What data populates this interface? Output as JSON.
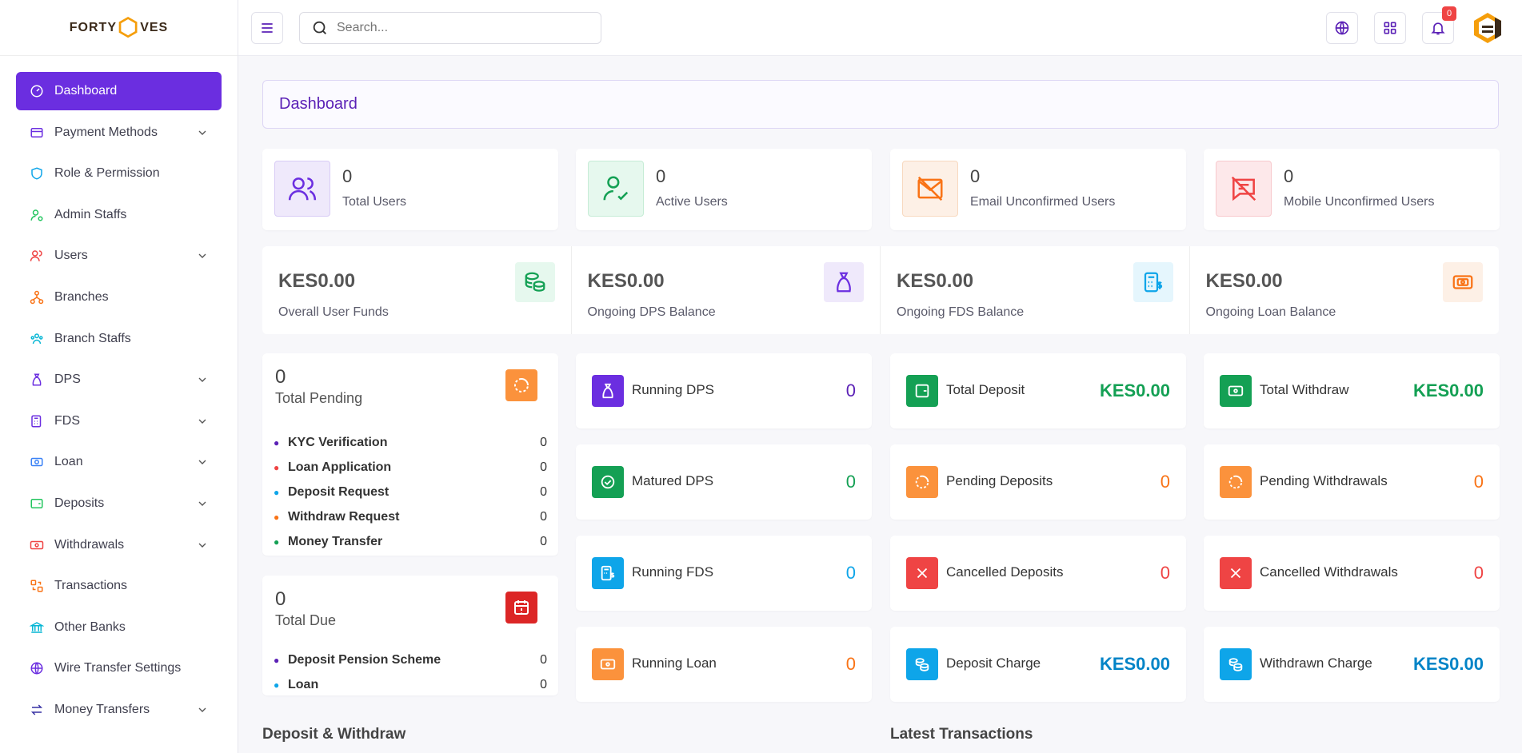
{
  "brand": {
    "logo_left": "FORTY",
    "logo_mid": "H",
    "logo_right": "VES"
  },
  "colors": {
    "accent": "#6b2ee0",
    "green": "#14a054",
    "orange": "#f97316",
    "red": "#ef4444",
    "blue": "#0ea5e9",
    "purple": "#5b21b6"
  },
  "sidebar": {
    "items": [
      {
        "label": "Dashboard",
        "icon": "dashboard-icon"
      },
      {
        "label": "Payment Methods",
        "icon": "credit-card-icon"
      },
      {
        "label": "Role & Permission",
        "icon": "shield-icon"
      },
      {
        "label": "Admin Staffs",
        "icon": "user-gear-icon"
      },
      {
        "label": "Users",
        "icon": "users-icon"
      },
      {
        "label": "Branches",
        "icon": "branches-icon"
      },
      {
        "label": "Branch Staffs",
        "icon": "staff-group-icon"
      },
      {
        "label": "DPS",
        "icon": "money-bag-icon"
      },
      {
        "label": "FDS",
        "icon": "calculator-icon"
      },
      {
        "label": "Loan",
        "icon": "loan-icon"
      },
      {
        "label": "Deposits",
        "icon": "wallet-icon"
      },
      {
        "label": "Withdrawals",
        "icon": "cash-icon"
      },
      {
        "label": "Transactions",
        "icon": "transfer-icon"
      },
      {
        "label": "Other Banks",
        "icon": "bank-icon"
      },
      {
        "label": "Wire Transfer Settings",
        "icon": "globe-icon"
      },
      {
        "label": "Money Transfers",
        "icon": "arrows-icon"
      }
    ]
  },
  "header": {
    "search_placeholder": "Search...",
    "notification_count": "0"
  },
  "page_title": "Dashboard",
  "stats": [
    {
      "value": "0",
      "label": "Total Users"
    },
    {
      "value": "0",
      "label": "Active Users"
    },
    {
      "value": "0",
      "label": "Email Unconfirmed Users"
    },
    {
      "value": "0",
      "label": "Mobile Unconfirmed Users"
    }
  ],
  "funds": [
    {
      "amount": "KES0.00",
      "label": "Overall User Funds"
    },
    {
      "amount": "KES0.00",
      "label": "Ongoing DPS Balance"
    },
    {
      "amount": "KES0.00",
      "label": "Ongoing FDS Balance"
    },
    {
      "amount": "KES0.00",
      "label": "Ongoing Loan Balance"
    }
  ],
  "pending": {
    "value": "0",
    "label": "Total Pending",
    "rows": [
      {
        "name": "KYC Verification",
        "value": "0"
      },
      {
        "name": "Loan Application",
        "value": "0"
      },
      {
        "name": "Deposit Request",
        "value": "0"
      },
      {
        "name": "Withdraw Request",
        "value": "0"
      },
      {
        "name": "Money Transfer",
        "value": "0"
      }
    ]
  },
  "due": {
    "value": "0",
    "label": "Total Due",
    "rows": [
      {
        "name": "Deposit Pension Scheme",
        "value": "0"
      },
      {
        "name": "Loan",
        "value": "0"
      }
    ]
  },
  "metrics": {
    "running_dps": {
      "name": "Running DPS",
      "value": "0"
    },
    "matured_dps": {
      "name": "Matured DPS",
      "value": "0"
    },
    "running_fds": {
      "name": "Running FDS",
      "value": "0"
    },
    "running_loan": {
      "name": "Running Loan",
      "value": "0"
    },
    "total_deposit": {
      "name": "Total Deposit",
      "value": "KES0.00"
    },
    "pending_deposits": {
      "name": "Pending Deposits",
      "value": "0"
    },
    "cancelled_deposits": {
      "name": "Cancelled Deposits",
      "value": "0"
    },
    "deposit_charge": {
      "name": "Deposit Charge",
      "value": "KES0.00"
    },
    "total_withdraw": {
      "name": "Total Withdraw",
      "value": "KES0.00"
    },
    "pending_withdrawals": {
      "name": "Pending Withdrawals",
      "value": "0"
    },
    "cancelled_withdrawals": {
      "name": "Cancelled Withdrawals",
      "value": "0"
    },
    "withdrawn_charge": {
      "name": "Withdrawn Charge",
      "value": "KES0.00"
    }
  },
  "sections": {
    "deposit_withdraw": "Deposit & Withdraw",
    "latest_transactions": "Latest Transactions"
  }
}
